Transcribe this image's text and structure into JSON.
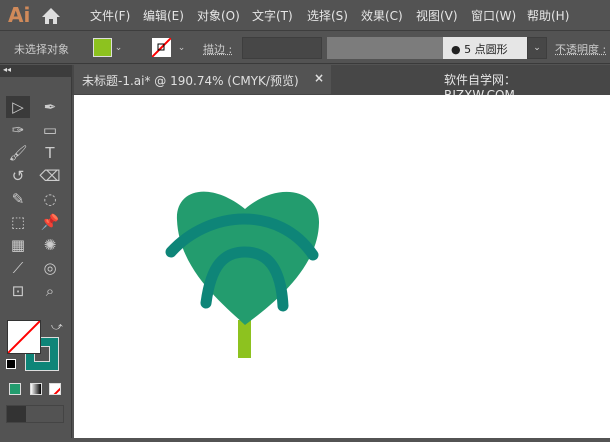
{
  "app": {
    "logo": "Ai"
  },
  "menu": [
    "文件(F)",
    "编辑(E)",
    "对象(O)",
    "文字(T)",
    "选择(S)",
    "效果(C)",
    "视图(V)",
    "窗口(W)",
    "帮助(H)"
  ],
  "control": {
    "selection": "未选择对象",
    "fill_color": "#8dc21f",
    "stroke_label": "描边 :",
    "brush": "5 点圆形",
    "opacity_label": "不透明度 :"
  },
  "tab": {
    "title": "未标题-1.ai* @ 190.74% (CMYK/预览)",
    "close": "×"
  },
  "watermark": "软件自学网：RJZXW.COM",
  "tools": [
    "selection-tool",
    "pen-tool",
    "curvature-tool",
    "rectangle-tool",
    "paintbrush-tool",
    "type-tool",
    "rotate-tool",
    "eraser-tool",
    "width-tool",
    "shape-builder-tool",
    "free-transform-tool",
    "puppet-warp-tool",
    "gradient-tool",
    "symbol-sprayer-tool",
    "eyedropper-tool",
    "blend-tool",
    "artboard-tool",
    "zoom-tool"
  ],
  "colors": {
    "fill": "none",
    "stroke": "#0e8578",
    "leaf": "#239c6e",
    "vein": "#0e8578",
    "stem": "#8dc21f"
  }
}
